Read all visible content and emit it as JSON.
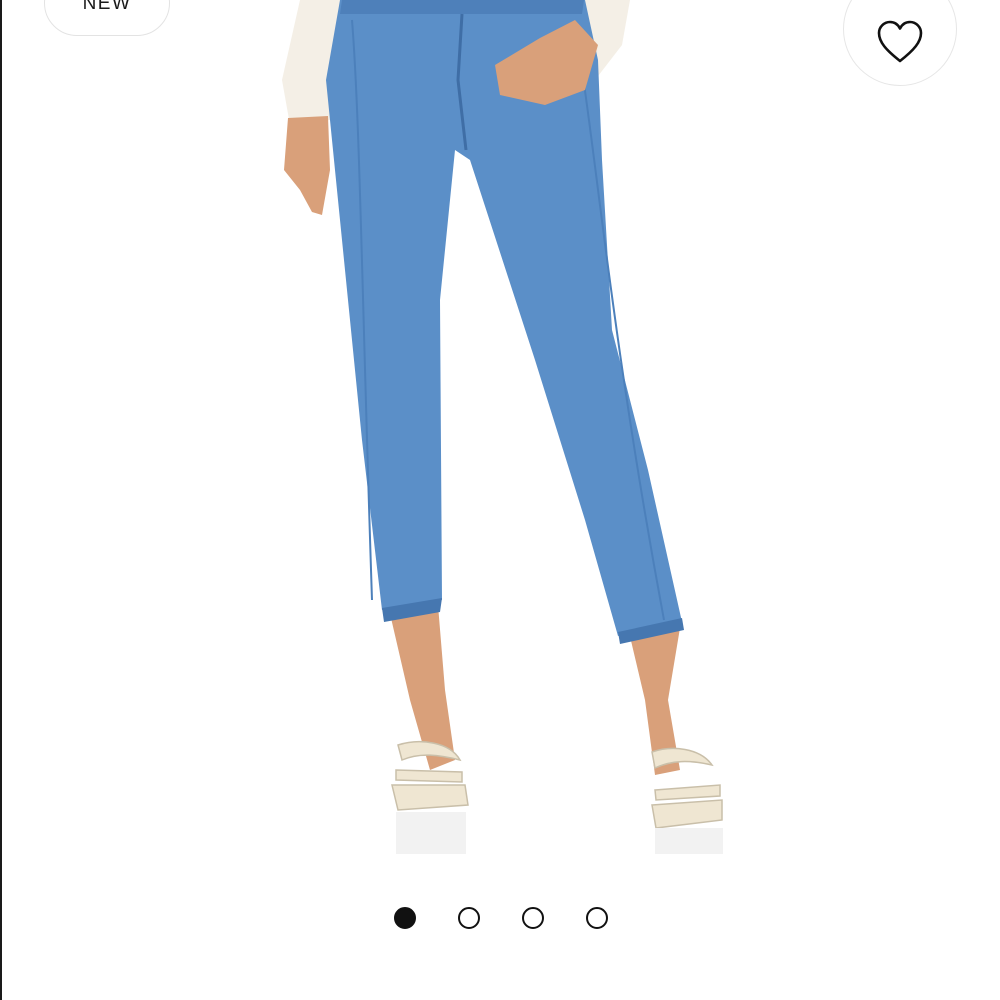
{
  "badge": {
    "label": "NEW"
  },
  "favorite": {
    "icon": "heart-icon"
  },
  "product_image": {
    "denim_color": "#5b8fc8",
    "denim_dark": "#4677b0",
    "skin_color": "#d9a07a",
    "sandal_color": "#efe6d2"
  },
  "carousel": {
    "total": 4,
    "active_index": 0
  }
}
